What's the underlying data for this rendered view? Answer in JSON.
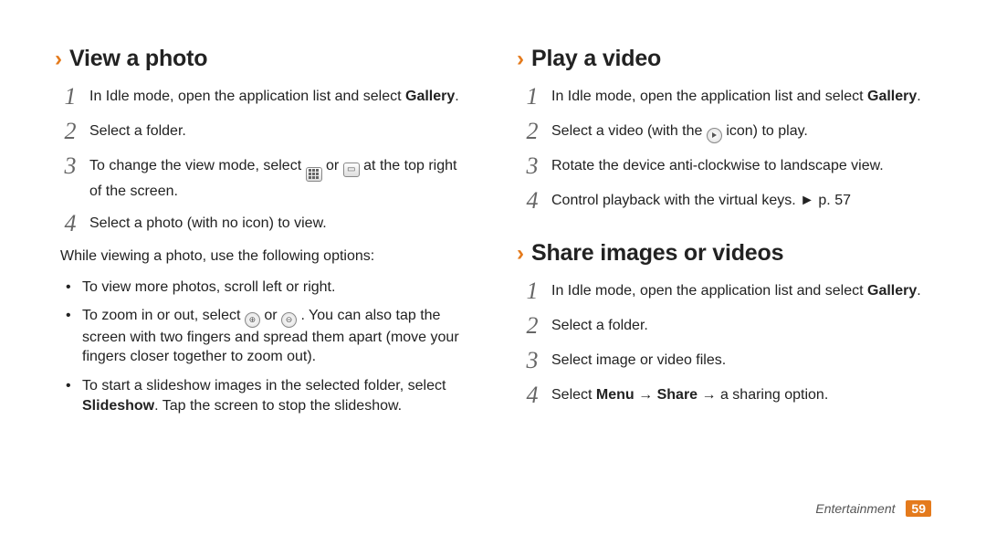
{
  "left": {
    "heading": "View a photo",
    "steps": [
      {
        "num": "1",
        "pre": "In Idle mode, open the application list and select ",
        "bold": "Gallery",
        "post": "."
      },
      {
        "num": "2",
        "pre": "Select a folder.",
        "bold": "",
        "post": ""
      },
      {
        "num": "3",
        "pre": "To change the view mode, select ",
        "mid1": " or ",
        "post": " at the top right of the screen."
      },
      {
        "num": "4",
        "pre": "Select a photo (with no icon) to view.",
        "bold": "",
        "post": ""
      }
    ],
    "para": "While viewing a photo, use the following options:",
    "bullets": [
      {
        "text": "To view more photos, scroll left or right."
      },
      {
        "pre": "To zoom in or out, select ",
        "mid": " or ",
        "post": ". You can also tap the screen with two fingers and spread them apart (move your fingers closer together to zoom out)."
      },
      {
        "pre": "To start a slideshow images in the selected folder, select ",
        "bold": "Slideshow",
        "post": ". Tap the screen to stop the slideshow."
      }
    ]
  },
  "right": {
    "play": {
      "heading": "Play a video",
      "steps": [
        {
          "num": "1",
          "pre": "In Idle mode, open the application list and select ",
          "bold": "Gallery",
          "post": "."
        },
        {
          "num": "2",
          "pre": "Select a video (with the ",
          "post": " icon) to play."
        },
        {
          "num": "3",
          "pre": "Rotate the device anti-clockwise to landscape view."
        },
        {
          "num": "4",
          "pre": "Control playback with the virtual keys. ► p. 57"
        }
      ]
    },
    "share": {
      "heading": "Share images or videos",
      "steps": [
        {
          "num": "1",
          "pre": "In Idle mode, open the application list and select ",
          "bold": "Gallery",
          "post": "."
        },
        {
          "num": "2",
          "pre": "Select a folder."
        },
        {
          "num": "3",
          "pre": "Select image or video files."
        },
        {
          "num": "4",
          "pre": "Select ",
          "bold1": "Menu",
          "arrow1": " → ",
          "bold2": "Share",
          "arrow2": " → ",
          "post": "a sharing option."
        }
      ]
    }
  },
  "footer": {
    "category": "Entertainment",
    "page": "59"
  }
}
